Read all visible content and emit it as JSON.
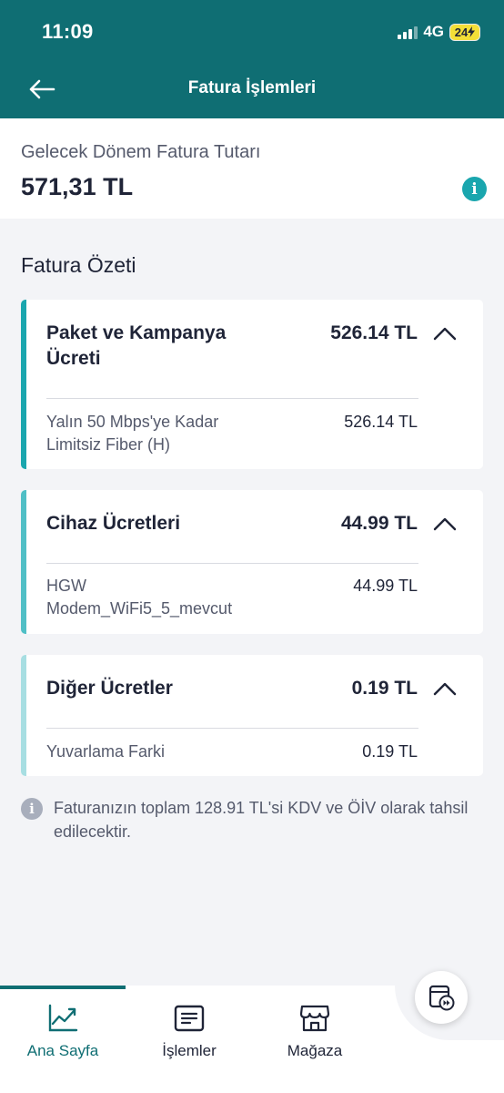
{
  "status_bar": {
    "time": "11:09",
    "network": "4G",
    "battery": "24"
  },
  "header": {
    "title": "Fatura İşlemleri"
  },
  "next_bill": {
    "label": "Gelecek Dönem Fatura Tutarı",
    "amount": "571,31 TL",
    "info_glyph": "i"
  },
  "summary": {
    "title": "Fatura Özeti",
    "cards": [
      {
        "title_line1": "Paket ve Kampanya",
        "title_line2": "Ücreti",
        "amount": "526.14 TL",
        "accent": "#1aa6ae",
        "item_line1": "Yalın 50 Mbps'ye Kadar",
        "item_line2": "Limitsiz Fiber (H)",
        "item_amount": "526.14 TL"
      },
      {
        "title_line1": "Cihaz Ücretleri",
        "amount": "44.99 TL",
        "accent": "#50bfc6",
        "item_line1": "HGW",
        "item_line2": "Modem_WiFi5_5_mevcut",
        "item_amount": "44.99 TL"
      },
      {
        "title_line1": "Diğer Ücretler",
        "amount": "0.19 TL",
        "accent": "#a7dee2",
        "item_line1": "Yuvarlama Farki",
        "item_amount": "0.19 TL"
      }
    ]
  },
  "tax_note": "Faturanızın toplam 128.91 TL'si KDV ve ÖİV olarak tahsil edilecektir.",
  "bottom_nav": {
    "items": [
      {
        "label": "Ana Sayfa",
        "icon": "chart-icon",
        "active": true
      },
      {
        "label": "İşlemler",
        "icon": "list-icon"
      },
      {
        "label": "Mağaza",
        "icon": "store-icon"
      }
    ],
    "fab_icon": "media-forward-icon"
  },
  "colors": {
    "header": "#0f6e73",
    "accent": "#1aa6ae",
    "background": "#f3f4f7"
  }
}
